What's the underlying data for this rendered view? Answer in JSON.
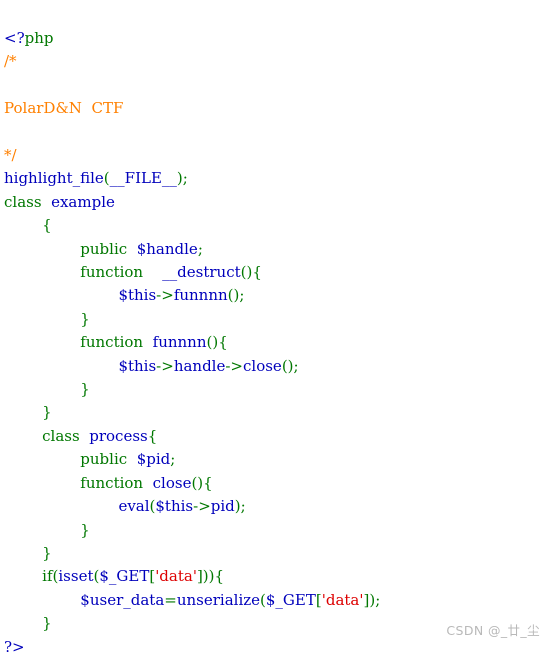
{
  "page": {
    "background_color": "#ffffff",
    "language": "php"
  },
  "palette": {
    "default": "#0000BB",
    "keyword": "#007700",
    "string": "#DD0000",
    "comment": "#FF8000",
    "html": "#000000",
    "watermark": "#b9b9b9"
  },
  "code": {
    "lines": [
      {
        "id": "line-1",
        "tokens": [
          {
            "t": "<?",
            "c": "default"
          },
          {
            "t": "php",
            "c": "keyword"
          }
        ]
      },
      {
        "id": "line-2",
        "tokens": [
          {
            "t": "/*",
            "c": "comment"
          }
        ]
      },
      {
        "id": "line-3",
        "tokens": [
          {
            "t": "",
            "c": "comment"
          }
        ]
      },
      {
        "id": "line-4",
        "tokens": [
          {
            "t": "PolarD&N  CTF",
            "c": "comment"
          }
        ]
      },
      {
        "id": "line-5",
        "tokens": [
          {
            "t": "",
            "c": "comment"
          }
        ]
      },
      {
        "id": "line-6",
        "tokens": [
          {
            "t": "*/",
            "c": "comment"
          }
        ]
      },
      {
        "id": "line-7",
        "tokens": [
          {
            "t": "highlight_file",
            "c": "default"
          },
          {
            "t": "(",
            "c": "keyword"
          },
          {
            "t": "__FILE__",
            "c": "default"
          },
          {
            "t": ");",
            "c": "keyword"
          }
        ]
      },
      {
        "id": "line-8",
        "tokens": [
          {
            "t": "class",
            "c": "keyword"
          },
          {
            "t": "  ",
            "c": "html"
          },
          {
            "t": "example",
            "c": "default"
          }
        ]
      },
      {
        "id": "line-9",
        "tokens": [
          {
            "t": "        ",
            "c": "html"
          },
          {
            "t": "{",
            "c": "keyword"
          }
        ]
      },
      {
        "id": "line-10",
        "tokens": [
          {
            "t": "                ",
            "c": "html"
          },
          {
            "t": "public",
            "c": "keyword"
          },
          {
            "t": "  ",
            "c": "html"
          },
          {
            "t": "$handle",
            "c": "default"
          },
          {
            "t": ";",
            "c": "keyword"
          }
        ]
      },
      {
        "id": "line-11",
        "tokens": [
          {
            "t": "                ",
            "c": "html"
          },
          {
            "t": "function",
            "c": "keyword"
          },
          {
            "t": "    ",
            "c": "html"
          },
          {
            "t": "__destruct",
            "c": "default"
          },
          {
            "t": "(){",
            "c": "keyword"
          }
        ]
      },
      {
        "id": "line-12",
        "tokens": [
          {
            "t": "                        ",
            "c": "html"
          },
          {
            "t": "$this",
            "c": "default"
          },
          {
            "t": "->",
            "c": "keyword"
          },
          {
            "t": "funnnn",
            "c": "default"
          },
          {
            "t": "();",
            "c": "keyword"
          }
        ]
      },
      {
        "id": "line-13",
        "tokens": [
          {
            "t": "                ",
            "c": "html"
          },
          {
            "t": "}",
            "c": "keyword"
          }
        ]
      },
      {
        "id": "line-14",
        "tokens": [
          {
            "t": "                ",
            "c": "html"
          },
          {
            "t": "function",
            "c": "keyword"
          },
          {
            "t": "  ",
            "c": "html"
          },
          {
            "t": "funnnn",
            "c": "default"
          },
          {
            "t": "(){",
            "c": "keyword"
          }
        ]
      },
      {
        "id": "line-15",
        "tokens": [
          {
            "t": "                        ",
            "c": "html"
          },
          {
            "t": "$this",
            "c": "default"
          },
          {
            "t": "->",
            "c": "keyword"
          },
          {
            "t": "handle",
            "c": "default"
          },
          {
            "t": "->",
            "c": "keyword"
          },
          {
            "t": "close",
            "c": "default"
          },
          {
            "t": "();",
            "c": "keyword"
          }
        ]
      },
      {
        "id": "line-16",
        "tokens": [
          {
            "t": "                ",
            "c": "html"
          },
          {
            "t": "}",
            "c": "keyword"
          }
        ]
      },
      {
        "id": "line-17",
        "tokens": [
          {
            "t": "        ",
            "c": "html"
          },
          {
            "t": "}",
            "c": "keyword"
          }
        ]
      },
      {
        "id": "line-18",
        "tokens": [
          {
            "t": "        ",
            "c": "html"
          },
          {
            "t": "class",
            "c": "keyword"
          },
          {
            "t": "  ",
            "c": "html"
          },
          {
            "t": "process",
            "c": "default"
          },
          {
            "t": "{",
            "c": "keyword"
          }
        ]
      },
      {
        "id": "line-19",
        "tokens": [
          {
            "t": "                ",
            "c": "html"
          },
          {
            "t": "public",
            "c": "keyword"
          },
          {
            "t": "  ",
            "c": "html"
          },
          {
            "t": "$pid",
            "c": "default"
          },
          {
            "t": ";",
            "c": "keyword"
          }
        ]
      },
      {
        "id": "line-20",
        "tokens": [
          {
            "t": "                ",
            "c": "html"
          },
          {
            "t": "function",
            "c": "keyword"
          },
          {
            "t": "  ",
            "c": "html"
          },
          {
            "t": "close",
            "c": "default"
          },
          {
            "t": "(){",
            "c": "keyword"
          }
        ]
      },
      {
        "id": "line-21",
        "tokens": [
          {
            "t": "                        ",
            "c": "html"
          },
          {
            "t": "eval",
            "c": "default"
          },
          {
            "t": "(",
            "c": "keyword"
          },
          {
            "t": "$this",
            "c": "default"
          },
          {
            "t": "->",
            "c": "keyword"
          },
          {
            "t": "pid",
            "c": "default"
          },
          {
            "t": ");",
            "c": "keyword"
          }
        ]
      },
      {
        "id": "line-22",
        "tokens": [
          {
            "t": "                ",
            "c": "html"
          },
          {
            "t": "}",
            "c": "keyword"
          }
        ]
      },
      {
        "id": "line-23",
        "tokens": [
          {
            "t": "        ",
            "c": "html"
          },
          {
            "t": "}",
            "c": "keyword"
          }
        ]
      },
      {
        "id": "line-24",
        "tokens": [
          {
            "t": "        ",
            "c": "html"
          },
          {
            "t": "if",
            "c": "keyword"
          },
          {
            "t": "(",
            "c": "keyword"
          },
          {
            "t": "isset",
            "c": "default"
          },
          {
            "t": "(",
            "c": "keyword"
          },
          {
            "t": "$_GET",
            "c": "default"
          },
          {
            "t": "[",
            "c": "keyword"
          },
          {
            "t": "'data'",
            "c": "string"
          },
          {
            "t": "])){",
            "c": "keyword"
          }
        ]
      },
      {
        "id": "line-25",
        "tokens": [
          {
            "t": "                ",
            "c": "html"
          },
          {
            "t": "$user_data",
            "c": "default"
          },
          {
            "t": "=",
            "c": "keyword"
          },
          {
            "t": "unserialize",
            "c": "default"
          },
          {
            "t": "(",
            "c": "keyword"
          },
          {
            "t": "$_GET",
            "c": "default"
          },
          {
            "t": "[",
            "c": "keyword"
          },
          {
            "t": "'data'",
            "c": "string"
          },
          {
            "t": "]);",
            "c": "keyword"
          }
        ]
      },
      {
        "id": "line-26",
        "tokens": [
          {
            "t": "        ",
            "c": "html"
          },
          {
            "t": "}",
            "c": "keyword"
          }
        ]
      },
      {
        "id": "line-27",
        "tokens": [
          {
            "t": "?>",
            "c": "default"
          }
        ]
      }
    ]
  },
  "watermark": {
    "text": "CSDN @_廿_尘"
  }
}
